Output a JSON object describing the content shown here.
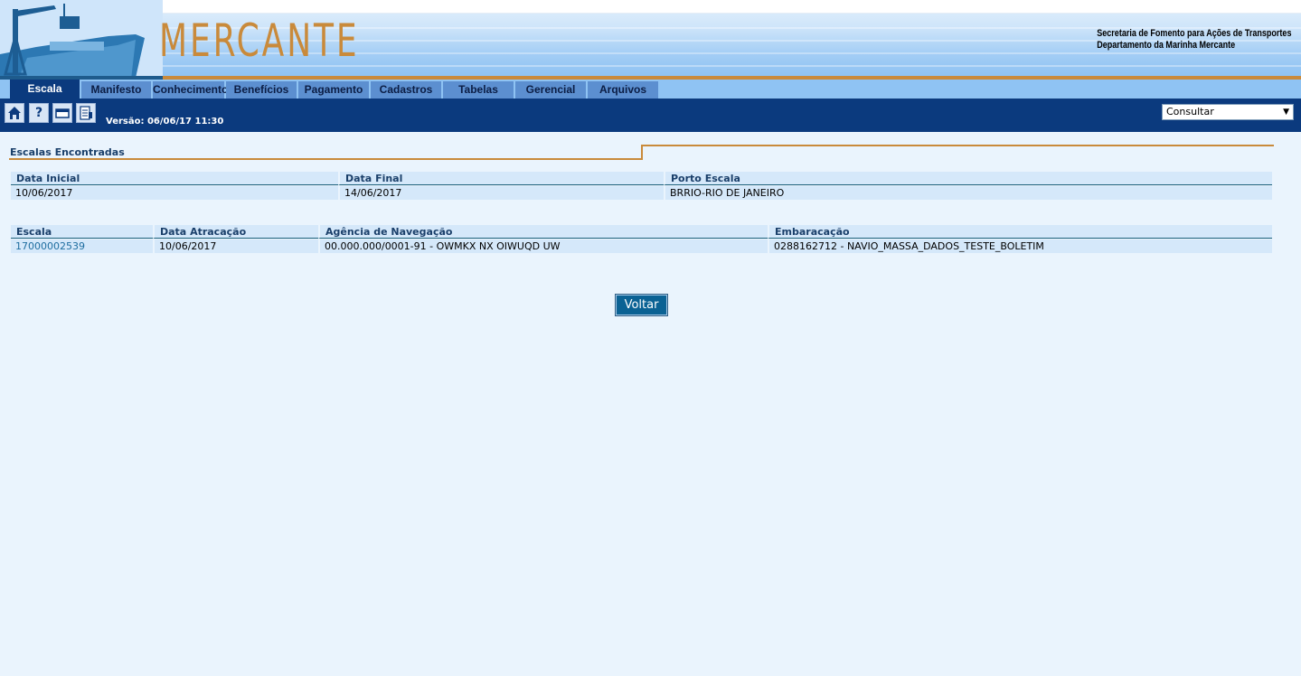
{
  "header": {
    "app_title": "MERCANTE",
    "org_line1": "Secretaria de Fomento para Ações de Transportes",
    "org_line2": "Departamento da Marinha Mercante"
  },
  "tabs": [
    {
      "label": "Escala",
      "active": true
    },
    {
      "label": "Manifesto"
    },
    {
      "label": "Conhecimento"
    },
    {
      "label": "Benefícios"
    },
    {
      "label": "Pagamento"
    },
    {
      "label": "Cadastros"
    },
    {
      "label": "Tabelas"
    },
    {
      "label": "Gerencial"
    },
    {
      "label": "Arquivos"
    }
  ],
  "toolbar": {
    "version": "Versão: 06/06/17 11:30",
    "action_select": "Consultar",
    "icons": [
      "home-icon",
      "help-icon",
      "window-icon",
      "print-icon"
    ]
  },
  "section": {
    "title": "Escalas Encontradas"
  },
  "filter_table": {
    "headers": [
      "Data Inicial",
      "Data Final",
      "Porto Escala"
    ],
    "row": [
      "10/06/2017",
      "14/06/2017",
      "BRRIO-RIO DE JANEIRO"
    ]
  },
  "results_table": {
    "headers": [
      "Escala",
      "Data Atracação",
      "Agência de Navegação",
      "Embaracação"
    ],
    "rows": [
      [
        "17000002539",
        "10/06/2017",
        "00.000.000/0001-91 - OWMKX NX OIWUQD UW",
        "0288162712 - NAVIO_MASSA_DADOS_TESTE_BOLETIM"
      ]
    ]
  },
  "actions": {
    "back_label": "Voltar"
  },
  "colors": {
    "accent": "#c98a3b",
    "navy": "#0b3a7e",
    "background": "#eaf4fd"
  }
}
